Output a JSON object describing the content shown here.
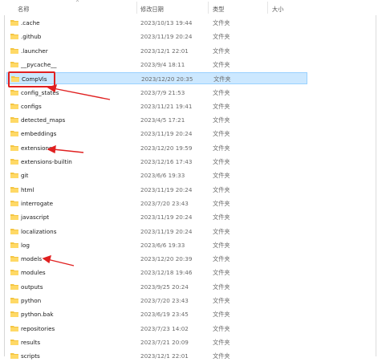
{
  "columns": {
    "name": "名称",
    "modified": "修改日期",
    "type": "类型",
    "size": "大小"
  },
  "folder_type": "文件夹",
  "colors": {
    "selected_bg": "#cce8ff",
    "folder": "#f4c542",
    "annotation": "#e02020"
  },
  "rows": [
    {
      "name": ".cache",
      "modified": "2023/10/13 19:44"
    },
    {
      "name": ".github",
      "modified": "2023/11/19 20:24"
    },
    {
      "name": ".launcher",
      "modified": "2023/12/1 22:01"
    },
    {
      "name": "__pycache__",
      "modified": "2023/9/4 18:11"
    },
    {
      "name": "CompVis",
      "modified": "2023/12/20 20:35",
      "selected": true
    },
    {
      "name": "config_states",
      "modified": "2023/7/9 21:53"
    },
    {
      "name": "configs",
      "modified": "2023/11/21 19:41"
    },
    {
      "name": "detected_maps",
      "modified": "2023/4/5 17:21"
    },
    {
      "name": "embeddings",
      "modified": "2023/11/19 20:24"
    },
    {
      "name": "extensions",
      "modified": "2023/12/20 19:59"
    },
    {
      "name": "extensions-builtin",
      "modified": "2023/12/16 17:43"
    },
    {
      "name": "git",
      "modified": "2023/6/6 19:33"
    },
    {
      "name": "html",
      "modified": "2023/11/19 20:24"
    },
    {
      "name": "interrogate",
      "modified": "2023/7/20 23:43"
    },
    {
      "name": "javascript",
      "modified": "2023/11/19 20:24"
    },
    {
      "name": "localizations",
      "modified": "2023/11/19 20:24"
    },
    {
      "name": "log",
      "modified": "2023/6/6 19:33"
    },
    {
      "name": "models",
      "modified": "2023/12/20 20:39"
    },
    {
      "name": "modules",
      "modified": "2023/12/18 19:46"
    },
    {
      "name": "outputs",
      "modified": "2023/9/25 20:24"
    },
    {
      "name": "python",
      "modified": "2023/7/20 23:43"
    },
    {
      "name": "python.bak",
      "modified": "2023/6/19 23:45"
    },
    {
      "name": "repositories",
      "modified": "2023/7/23 14:02"
    },
    {
      "name": "results",
      "modified": "2023/7/21 20:09"
    },
    {
      "name": "scripts",
      "modified": "2023/12/1 22:01"
    }
  ]
}
